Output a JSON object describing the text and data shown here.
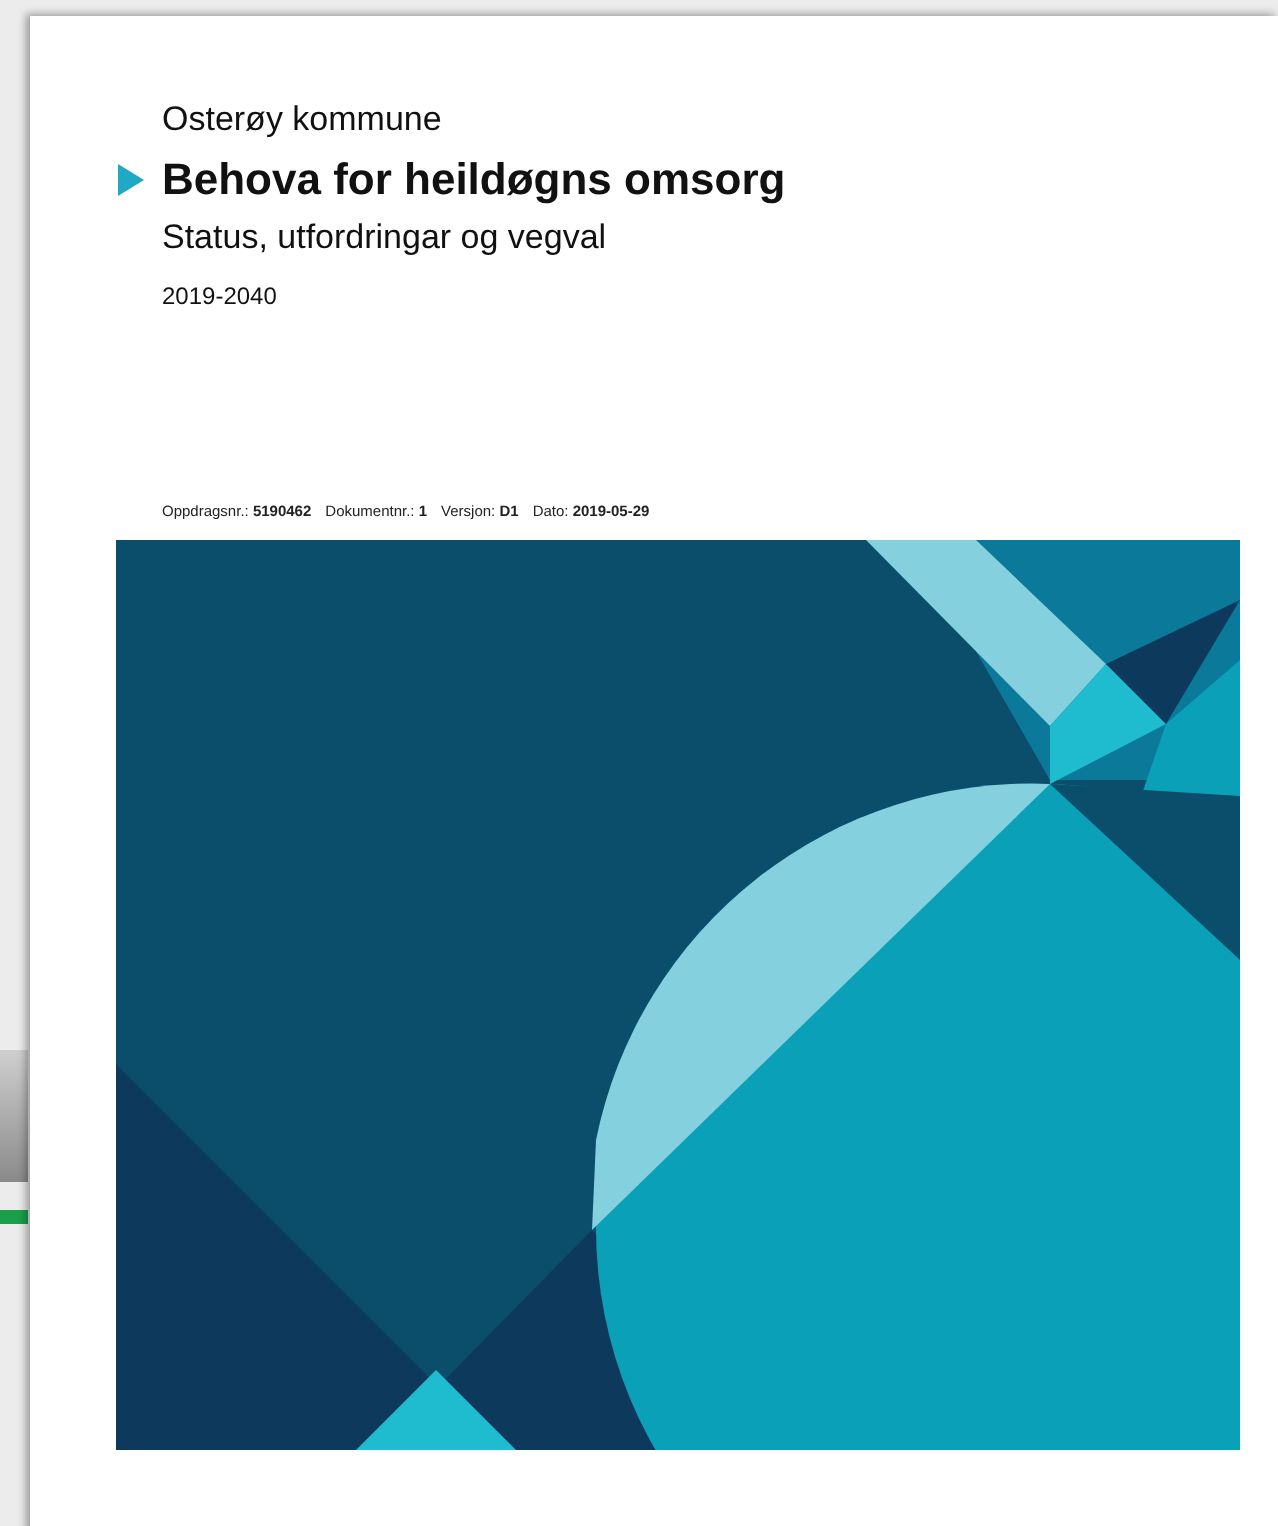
{
  "document": {
    "organisation": "Osterøy kommune",
    "title": "Behova for heildøgns omsorg",
    "subtitle": "Status, utfordringar og vegval",
    "period": "2019-2040",
    "metadata": [
      {
        "text": "Oppdragsnr.: **5190462**"
      },
      {
        "text": "Dokumentnr.: **1**"
      },
      {
        "text": "Versjon: **D1**"
      },
      {
        "text": "Dato: **2019-05-29**"
      }
    ]
  }
}
